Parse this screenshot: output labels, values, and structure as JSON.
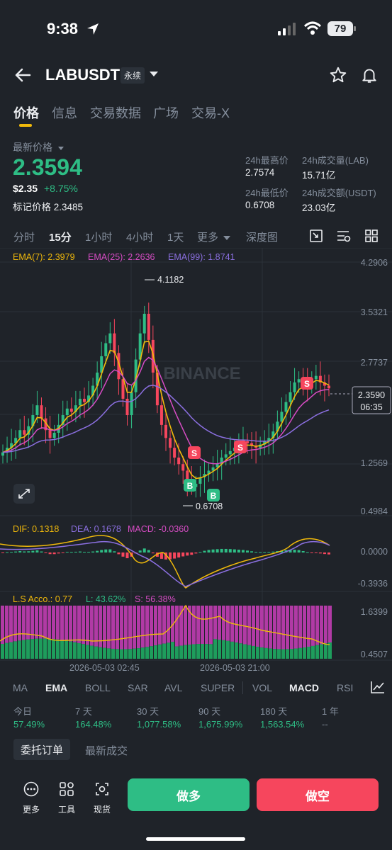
{
  "status_bar": {
    "time": "9:38",
    "battery": "79"
  },
  "header": {
    "symbol": "LABUSDT",
    "badge": "永续"
  },
  "tabs": [
    "价格",
    "信息",
    "交易数据",
    "广场",
    "交易-X"
  ],
  "price": {
    "latest_label": "最新价格",
    "last": "2.3594",
    "usd": "$2.35",
    "change": "+8.75%",
    "mark_label": "标记价格 2.3485"
  },
  "stats": {
    "high_label": "24h最高价",
    "high_value": "2.7574",
    "low_label": "24h最低价",
    "low_value": "0.6708",
    "vol_lab_label": "24h成交量(LAB)",
    "vol_lab_value": "15.71亿",
    "vol_usdt_label": "24h成交额(USDT)",
    "vol_usdt_value": "23.03亿"
  },
  "intervals": [
    "分时",
    "15分",
    "1小时",
    "4小时",
    "1天",
    "更多",
    "深度图"
  ],
  "active_interval": "15分",
  "chart_data": {
    "type": "candlestick",
    "ema_legend": {
      "ema7": "EMA(7): 2.3979",
      "ema25": "EMA(25): 2.2636",
      "ema99": "EMA(99): 1.8741"
    },
    "price_axis": [
      "4.2906",
      "3.5321",
      "2.7737",
      "1.2569",
      "0.4984"
    ],
    "price_range": [
      0.4984,
      4.2906
    ],
    "high_marker": "4.1182",
    "low_marker": "0.6708",
    "current_price_tag": "2.3590",
    "countdown": "06:35",
    "watermark": "BINANCE",
    "time_labels": [
      "2026-05-03 02:45",
      "2026-05-03 21:00"
    ],
    "buy_markers": [
      "B",
      "B"
    ],
    "sell_markers": [
      "S",
      "S",
      "S"
    ],
    "series_close": [
      1.38,
      1.45,
      1.52,
      1.6,
      1.72,
      1.65,
      1.78,
      1.95,
      2.1,
      1.9,
      1.72,
      1.6,
      1.68,
      1.8,
      1.95,
      2.05,
      2.0,
      2.1,
      2.2,
      2.15,
      2.25,
      2.4,
      2.6,
      2.85,
      3.05,
      3.2,
      2.9,
      2.5,
      2.2,
      1.95,
      2.3,
      2.8,
      3.2,
      3.5,
      3.1,
      2.6,
      2.1,
      1.8,
      1.6,
      1.45,
      1.3,
      1.2,
      1.1,
      0.95,
      0.85,
      0.9,
      1.0,
      1.05,
      1.1,
      1.15,
      1.2,
      1.3,
      1.35,
      1.4,
      1.45,
      1.5,
      1.55,
      1.52,
      1.48,
      1.45,
      1.5,
      1.55,
      1.6,
      1.7,
      1.85,
      2.0,
      2.15,
      2.3,
      2.45,
      2.5,
      2.45,
      2.4,
      2.5,
      2.55,
      2.45,
      2.4,
      2.36
    ],
    "macd": {
      "dif": "DIF: 0.1318",
      "dea": "DEA: 0.1678",
      "macd": "MACD: -0.0360",
      "axis": [
        "0.0000",
        "-0.3936"
      ]
    },
    "ls": {
      "ratio": "L.S Acco.: 0.77",
      "long": "L: 43.62%",
      "short": "S: 56.38%",
      "axis": [
        "1.6399",
        "0.4507"
      ]
    }
  },
  "indicators": [
    "MA",
    "EMA",
    "BOLL",
    "SAR",
    "AVL",
    "SUPER",
    "VOL",
    "MACD",
    "RSI"
  ],
  "performance": [
    {
      "label": "今日",
      "value": "57.49%"
    },
    {
      "label": "7 天",
      "value": "164.48%"
    },
    {
      "label": "30 天",
      "value": "1,077.58%"
    },
    {
      "label": "90 天",
      "value": "1,675.99%"
    },
    {
      "label": "180 天",
      "value": "1,563.54%"
    },
    {
      "label": "1 年",
      "value": "--"
    }
  ],
  "order_tabs": {
    "orders": "委托订单",
    "trades": "最新成交"
  },
  "bottom": {
    "more": "更多",
    "tools": "工具",
    "spot": "现货",
    "long": "做多",
    "short": "做空"
  },
  "colors": {
    "up": "#2ebd85",
    "down": "#f6465d",
    "ema7": "#f0b90b",
    "ema25": "#d64cc4",
    "ema99": "#8b6fe0",
    "accent": "#f0b90b"
  }
}
